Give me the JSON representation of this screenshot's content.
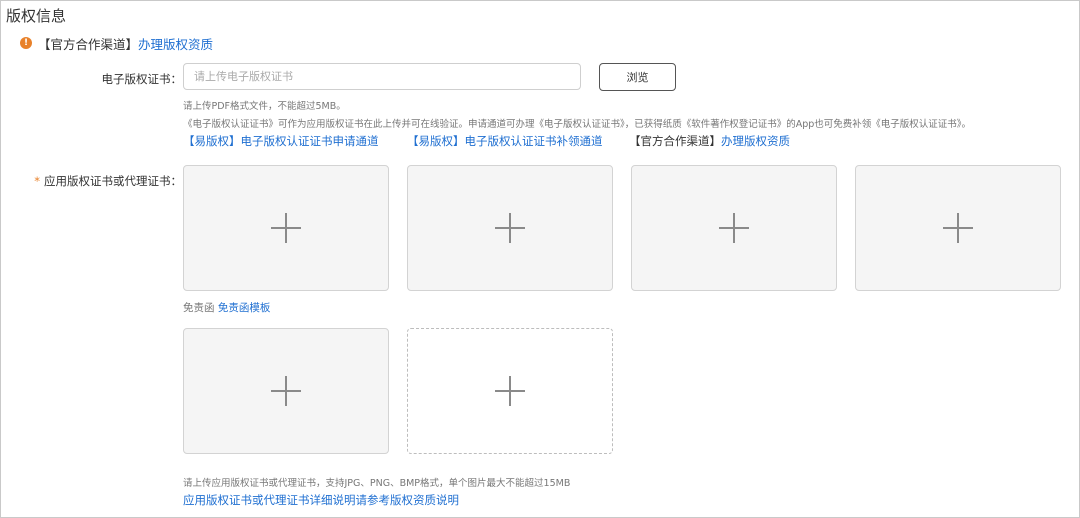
{
  "section": {
    "title": "版权信息"
  },
  "notice": {
    "icon": "warning-icon",
    "icon_glyph": "!",
    "bracket_text": "【官方合作渠道】",
    "link": "办理版权资质",
    "accent_color": "#e8812a"
  },
  "cert_field": {
    "label": "电子版权证书：",
    "placeholder": "请上传电子版权证书",
    "value": "",
    "browse_button": "浏览",
    "hint_line1": "请上传PDF格式文件，不能超过5MB。",
    "hint_line2": "《电子版权认证证书》可作为应用版权证书在此上传并可在线验证。申请通道可办理《电子版权认证证书》，已获得纸质《软件著作权登记证书》的App也可免费补领《电子版权认证证书》。",
    "link_apply": "【易版权】电子版权认证证书申请通道",
    "link_reissue": "【易版权】电子版权认证证书补领通道",
    "official_bracket": "【官方合作渠道】",
    "official_link": "办理版权资质"
  },
  "app_cert_field": {
    "required_mark": "*",
    "label": "应用版权证书或代理证书：",
    "disclaimer_text": "免责函",
    "disclaimer_link": "免责函模板",
    "footer_hint": "请上传应用版权证书或代理证书，支持JPG、PNG、BMP格式，单个图片最大不能超过15MB",
    "footer_link": "应用版权证书或代理证书详细说明请参考版权资质说明"
  },
  "colors": {
    "link": "#1f6fd1",
    "required": "#e8812a",
    "border": "#c9c9c9"
  }
}
